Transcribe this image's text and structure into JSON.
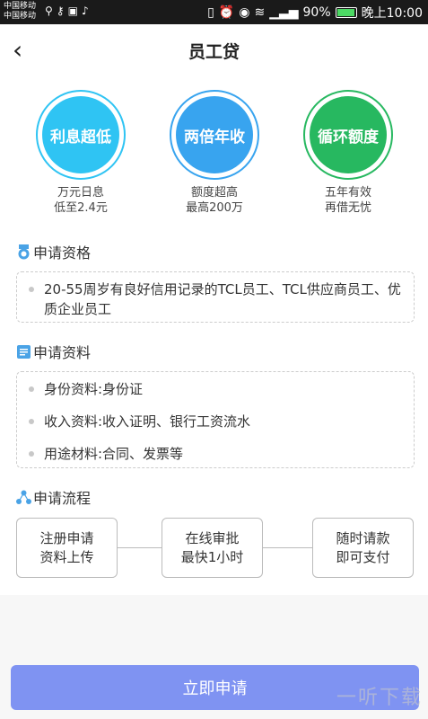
{
  "status_bar": {
    "carrier_1": "中国移动",
    "carrier_2": "中国移动",
    "battery": "90%",
    "time": "晚上10:00"
  },
  "nav": {
    "title": "员工贷"
  },
  "features": [
    {
      "label": "利息超低",
      "line1": "万元日息",
      "line2": "低至2.4元",
      "color": "#2fc4f3"
    },
    {
      "label": "两倍年收",
      "line1": "额度超高",
      "line2": "最高200万",
      "color": "#38a4ef"
    },
    {
      "label": "循环额度",
      "line1": "五年有效",
      "line2": "再借无忧",
      "color": "#27b860"
    }
  ],
  "qualification": {
    "heading": "申请资格",
    "items": [
      "20-55周岁有良好信用记录的TCL员工、TCL供应商员工、优质企业员工"
    ]
  },
  "materials": {
    "heading": "申请资料",
    "items": [
      "身份资料:身份证",
      "收入资料:收入证明、银行工资流水",
      "用途材料:合同、发票等"
    ]
  },
  "process": {
    "heading": "申请流程",
    "steps": [
      {
        "line1": "注册申请",
        "line2": "资料上传"
      },
      {
        "line1": "在线审批",
        "line2": "最快1小时"
      },
      {
        "line1": "随时请款",
        "line2": "即可支付"
      }
    ]
  },
  "apply_button": "立即申请",
  "watermark": "一听下载"
}
